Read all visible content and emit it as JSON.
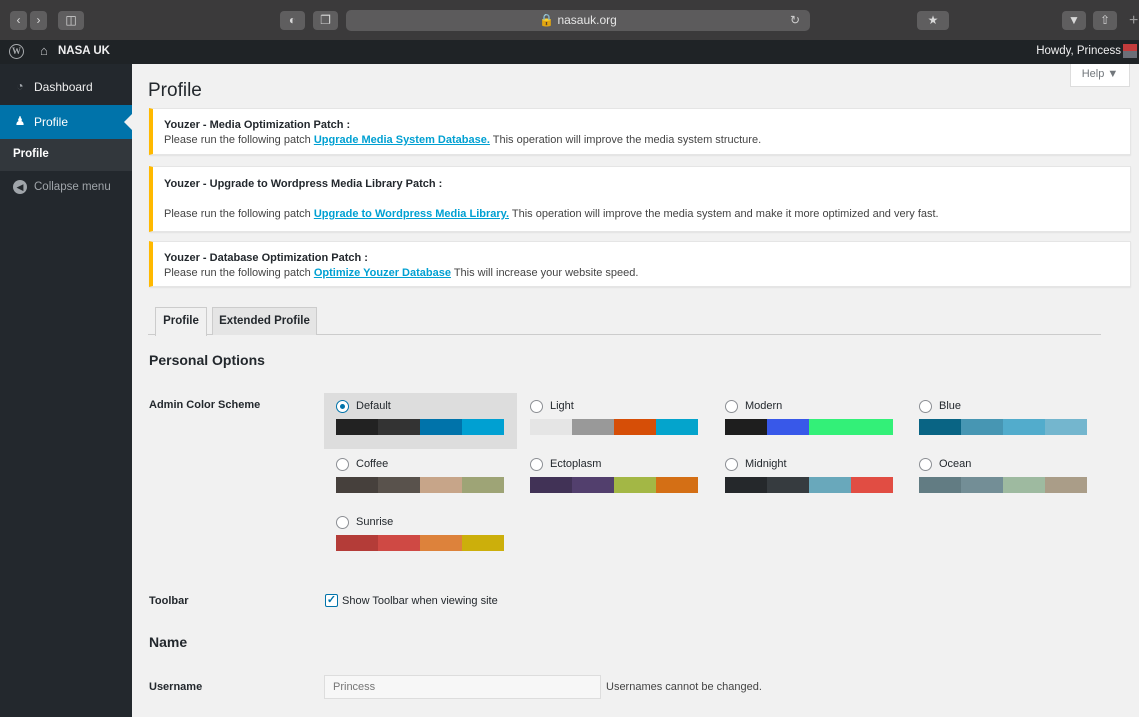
{
  "browser": {
    "back_icon": "chevron-left-icon",
    "forward_icon": "chevron-right-icon",
    "address": "🔒 nasauk.org",
    "reload_icon": "reload-icon"
  },
  "admin_bar": {
    "site_name": "NASA UK",
    "greeting": "Howdy, Princess"
  },
  "sidebar": {
    "items": [
      {
        "label": "Dashboard",
        "icon": "dashboard-icon"
      },
      {
        "label": "Profile",
        "icon": "user-icon"
      }
    ],
    "submenu": {
      "label": "Profile"
    },
    "collapse": {
      "label": "Collapse menu",
      "icon": "collapse-icon"
    }
  },
  "help": {
    "label": "Help ▼"
  },
  "page": {
    "title": "Profile"
  },
  "notices": [
    {
      "title": "Youzer - Media Optimization Patch :",
      "text_before": "Please run the following patch ",
      "link": "Upgrade Media System Database.",
      "text_after": " This operation will improve the media system structure."
    },
    {
      "title": "Youzer - Upgrade to Wordpress Media Library Patch :",
      "text_before": "Please run the following patch ",
      "link": "Upgrade to Wordpress Media Library.",
      "text_after": " This operation will improve the media system and make it more optimized and very fast."
    },
    {
      "title": "Youzer - Database Optimization Patch :",
      "text_before": "Please run the following patch ",
      "link": "Optimize Youzer Database",
      "text_after": " This will increase your website speed."
    }
  ],
  "tabs": [
    {
      "label": "Profile",
      "active": true
    },
    {
      "label": "Extended Profile",
      "active": false
    }
  ],
  "personal_options": {
    "title": "Personal Options",
    "color_scheme_label": "Admin Color Scheme",
    "schemes": [
      {
        "name": "Default",
        "selected": true,
        "colors": [
          "#222222",
          "#333333",
          "#0073aa",
          "#00a0d2"
        ]
      },
      {
        "name": "Light",
        "selected": false,
        "colors": [
          "#e5e5e5",
          "#999999",
          "#d64e07",
          "#04a4cc"
        ]
      },
      {
        "name": "Modern",
        "selected": false,
        "colors": [
          "#1e1e1e",
          "#3858e9",
          "#33f078",
          "#33f078"
        ]
      },
      {
        "name": "Blue",
        "selected": false,
        "colors": [
          "#096484",
          "#4796b3",
          "#52accc",
          "#74b6ce"
        ]
      },
      {
        "name": "Coffee",
        "selected": false,
        "colors": [
          "#46403c",
          "#59524c",
          "#c7a589",
          "#9ea476"
        ]
      },
      {
        "name": "Ectoplasm",
        "selected": false,
        "colors": [
          "#413256",
          "#523f6d",
          "#a3b745",
          "#d46f15"
        ]
      },
      {
        "name": "Midnight",
        "selected": false,
        "colors": [
          "#25282b",
          "#363b3f",
          "#69a8bb",
          "#e14d43"
        ]
      },
      {
        "name": "Ocean",
        "selected": false,
        "colors": [
          "#627c83",
          "#738e96",
          "#9ebaa0",
          "#aa9d88"
        ]
      },
      {
        "name": "Sunrise",
        "selected": false,
        "colors": [
          "#b43c38",
          "#cf4944",
          "#dd823b",
          "#ccaf0b"
        ]
      }
    ],
    "toolbar_label": "Toolbar",
    "toolbar_checkbox_label": "Show Toolbar when viewing site",
    "toolbar_checked": true
  },
  "name_section": {
    "title": "Name",
    "username_label": "Username",
    "username_value": "Princess",
    "username_desc": "Usernames cannot be changed."
  }
}
